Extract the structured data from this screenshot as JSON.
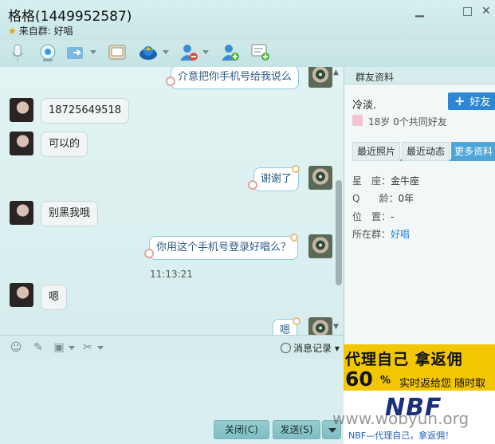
{
  "window": {
    "title": "格格(1449952587)",
    "subtitle_prefix": "来自群:",
    "subtitle_group": "好唱",
    "controls": [
      "minimize",
      "maximize",
      "close"
    ]
  },
  "toolbar": {
    "icons": [
      "microphone-icon",
      "webcam-icon",
      "file-transfer-icon",
      "remote-assist-icon",
      "app-icon",
      "block-user-icon",
      "add-contact-icon",
      "message-add-icon"
    ]
  },
  "chat": {
    "messages": [
      {
        "side": "right",
        "text": "介意把你手机号给我说么"
      },
      {
        "side": "left",
        "text": "18725649518"
      },
      {
        "side": "left",
        "text": "可以的"
      },
      {
        "side": "right",
        "text": "谢谢了"
      },
      {
        "side": "left",
        "text": "别黑我哦"
      },
      {
        "side": "right",
        "text": "你用这个手机号登录好唱么？"
      },
      {
        "side": "left",
        "text": "嗯"
      },
      {
        "side": "right",
        "text": "嗯"
      }
    ],
    "timestamp": "11:13:21"
  },
  "input_toolbar": {
    "history_label": "消息记录"
  },
  "buttons": {
    "close_label": "关闭(C)",
    "send_label": "发送(S)"
  },
  "profile": {
    "header": "群友资料",
    "nickname": "冷淡.",
    "add_label": "好友",
    "age_info": "18岁  0个共同好友",
    "tabs": [
      "最近照片",
      "最近动态",
      "更多资料"
    ],
    "rows": [
      {
        "label": "星　座：",
        "value": "金牛座"
      },
      {
        "label": "Q　　龄：",
        "value": "0年"
      },
      {
        "label": "位　置：",
        "value": "-"
      },
      {
        "label": "所在群：",
        "value": "好唱"
      }
    ]
  },
  "ad": {
    "line1": "代理自己 拿返佣",
    "big_number": "60",
    "percent": "%",
    "line2": "实时返给您 随时取",
    "logo": "NBF",
    "caption": "NBF—代理自己，拿返佣！"
  },
  "watermark": "www.wobyun.org"
}
